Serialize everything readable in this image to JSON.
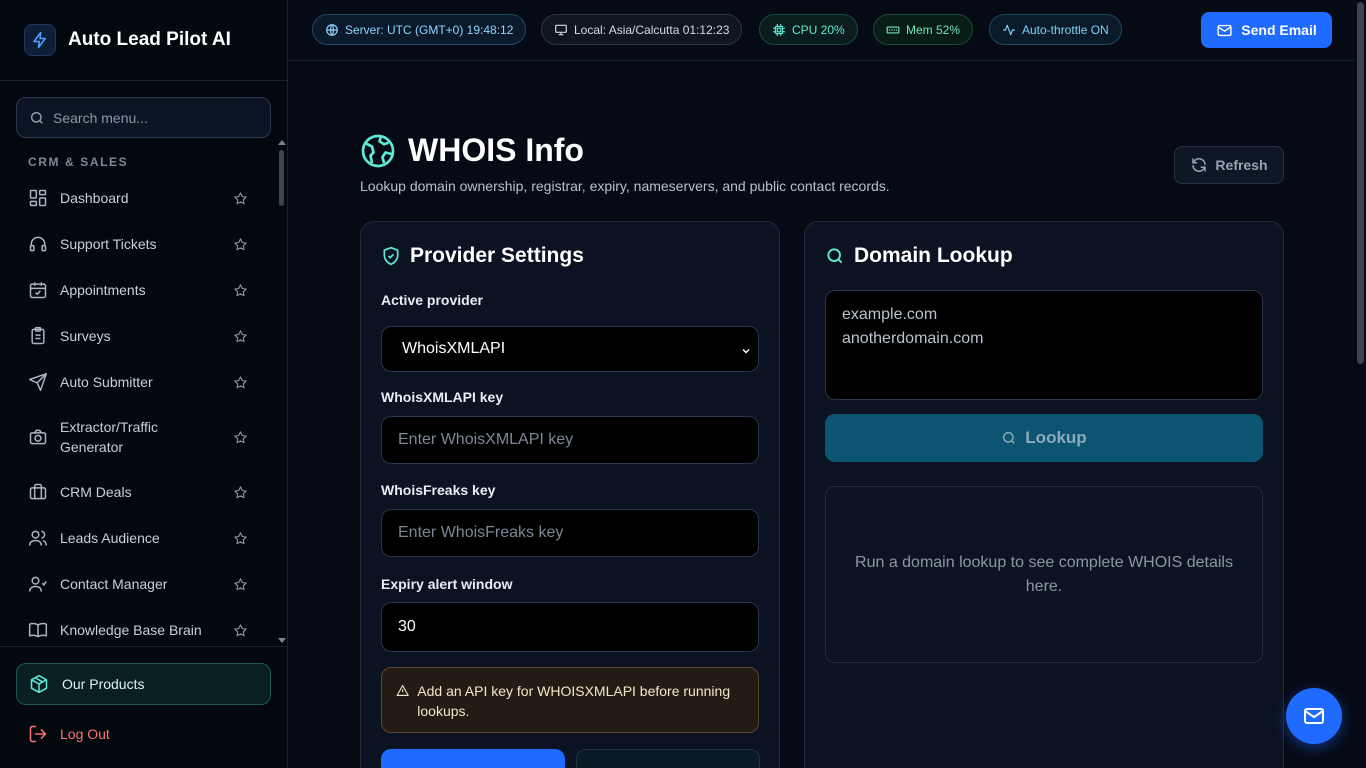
{
  "brand": {
    "name": "Auto Lead Pilot AI"
  },
  "sidebar": {
    "search_placeholder": "Search menu...",
    "section": "CRM & SALES",
    "items": [
      {
        "label": "Dashboard",
        "icon": "dashboard-icon"
      },
      {
        "label": "Support Tickets",
        "icon": "headset-icon"
      },
      {
        "label": "Appointments",
        "icon": "calendar-check-icon"
      },
      {
        "label": "Surveys",
        "icon": "clipboard-icon"
      },
      {
        "label": "Auto Submitter",
        "icon": "send-icon"
      },
      {
        "label": "Extractor/Traffic Generator",
        "icon": "camera-icon"
      },
      {
        "label": "CRM Deals",
        "icon": "briefcase-icon"
      },
      {
        "label": "Leads Audience",
        "icon": "users-icon"
      },
      {
        "label": "Contact Manager",
        "icon": "contacts-icon"
      },
      {
        "label": "Knowledge Base Brain",
        "icon": "book-icon"
      }
    ],
    "products_label": "Our Products",
    "logout_label": "Log Out"
  },
  "topbar": {
    "server": "Server: UTC (GMT+0) 19:48:12",
    "local": "Local: Asia/Calcutta 01:12:23",
    "cpu": "CPU 20%",
    "mem": "Mem 52%",
    "throttle": "Auto-throttle ON",
    "send_email": "Send Email"
  },
  "page": {
    "title": "WHOIS Info",
    "subtitle": "Lookup domain ownership, registrar, expiry, nameservers, and public contact records.",
    "refresh": "Refresh"
  },
  "provider": {
    "title": "Provider Settings",
    "active_label": "Active provider",
    "active_value": "WhoisXMLAPI",
    "xml_label": "WhoisXMLAPI key",
    "xml_placeholder": "Enter WhoisXMLAPI key",
    "freaks_label": "WhoisFreaks key",
    "freaks_placeholder": "Enter WhoisFreaks key",
    "expiry_label": "Expiry alert window",
    "expiry_value": "30",
    "alert": "Add an API key for WHOISXMLAPI before running lookups."
  },
  "lookup": {
    "title": "Domain Lookup",
    "placeholder": "example.com\nanotherdomain.com",
    "button": "Lookup",
    "empty": "Run a domain lookup to see complete WHOIS details here."
  },
  "colors": {
    "accent_blue": "#1f6bff",
    "accent_teal": "#5eead4",
    "danger": "#f87171"
  }
}
